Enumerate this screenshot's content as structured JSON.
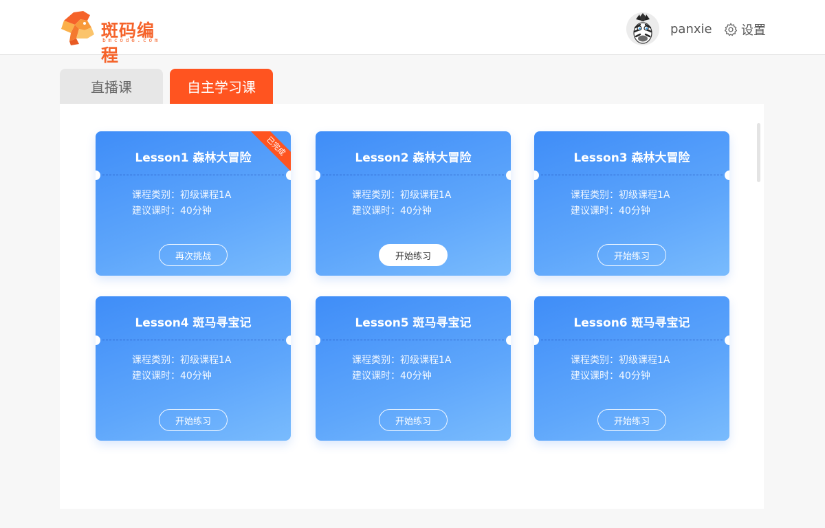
{
  "header": {
    "logo_text": "斑码编程",
    "logo_subtext": "bmcode.com",
    "username": "panxie",
    "settings_label": "设置"
  },
  "tabs": [
    {
      "label": "直播课",
      "active": false
    },
    {
      "label": "自主学习课",
      "active": true
    }
  ],
  "lessons": [
    {
      "title": "Lesson1 森林大冒险",
      "category": "课程类别：初级课程1A",
      "duration": "建议课时：40分钟",
      "button": "再次挑战",
      "badge": "已完成",
      "button_style": "outline"
    },
    {
      "title": "Lesson2 森林大冒险",
      "category": "课程类别：初级课程1A",
      "duration": "建议课时：40分钟",
      "button": "开始练习",
      "button_style": "solid"
    },
    {
      "title": "Lesson3 森林大冒险",
      "category": "课程类别：初级课程1A",
      "duration": "建议课时：40分钟",
      "button": "开始练习",
      "button_style": "outline"
    },
    {
      "title": "Lesson4 斑马寻宝记",
      "category": "课程类别：初级课程1A",
      "duration": "建议课时：40分钟",
      "button": "开始练习",
      "button_style": "outline"
    },
    {
      "title": "Lesson5 斑马寻宝记",
      "category": "课程类别：初级课程1A",
      "duration": "建议课时：40分钟",
      "button": "开始练习",
      "button_style": "outline"
    },
    {
      "title": "Lesson6 斑马寻宝记",
      "category": "课程类别：初级课程1A",
      "duration": "建议课时：40分钟",
      "button": "开始练习",
      "button_style": "outline"
    }
  ],
  "colors": {
    "accent": "#ff5420",
    "brand": "#f5632a",
    "card_gradient_start": "#3f8df8",
    "card_gradient_end": "#79bbfd"
  }
}
